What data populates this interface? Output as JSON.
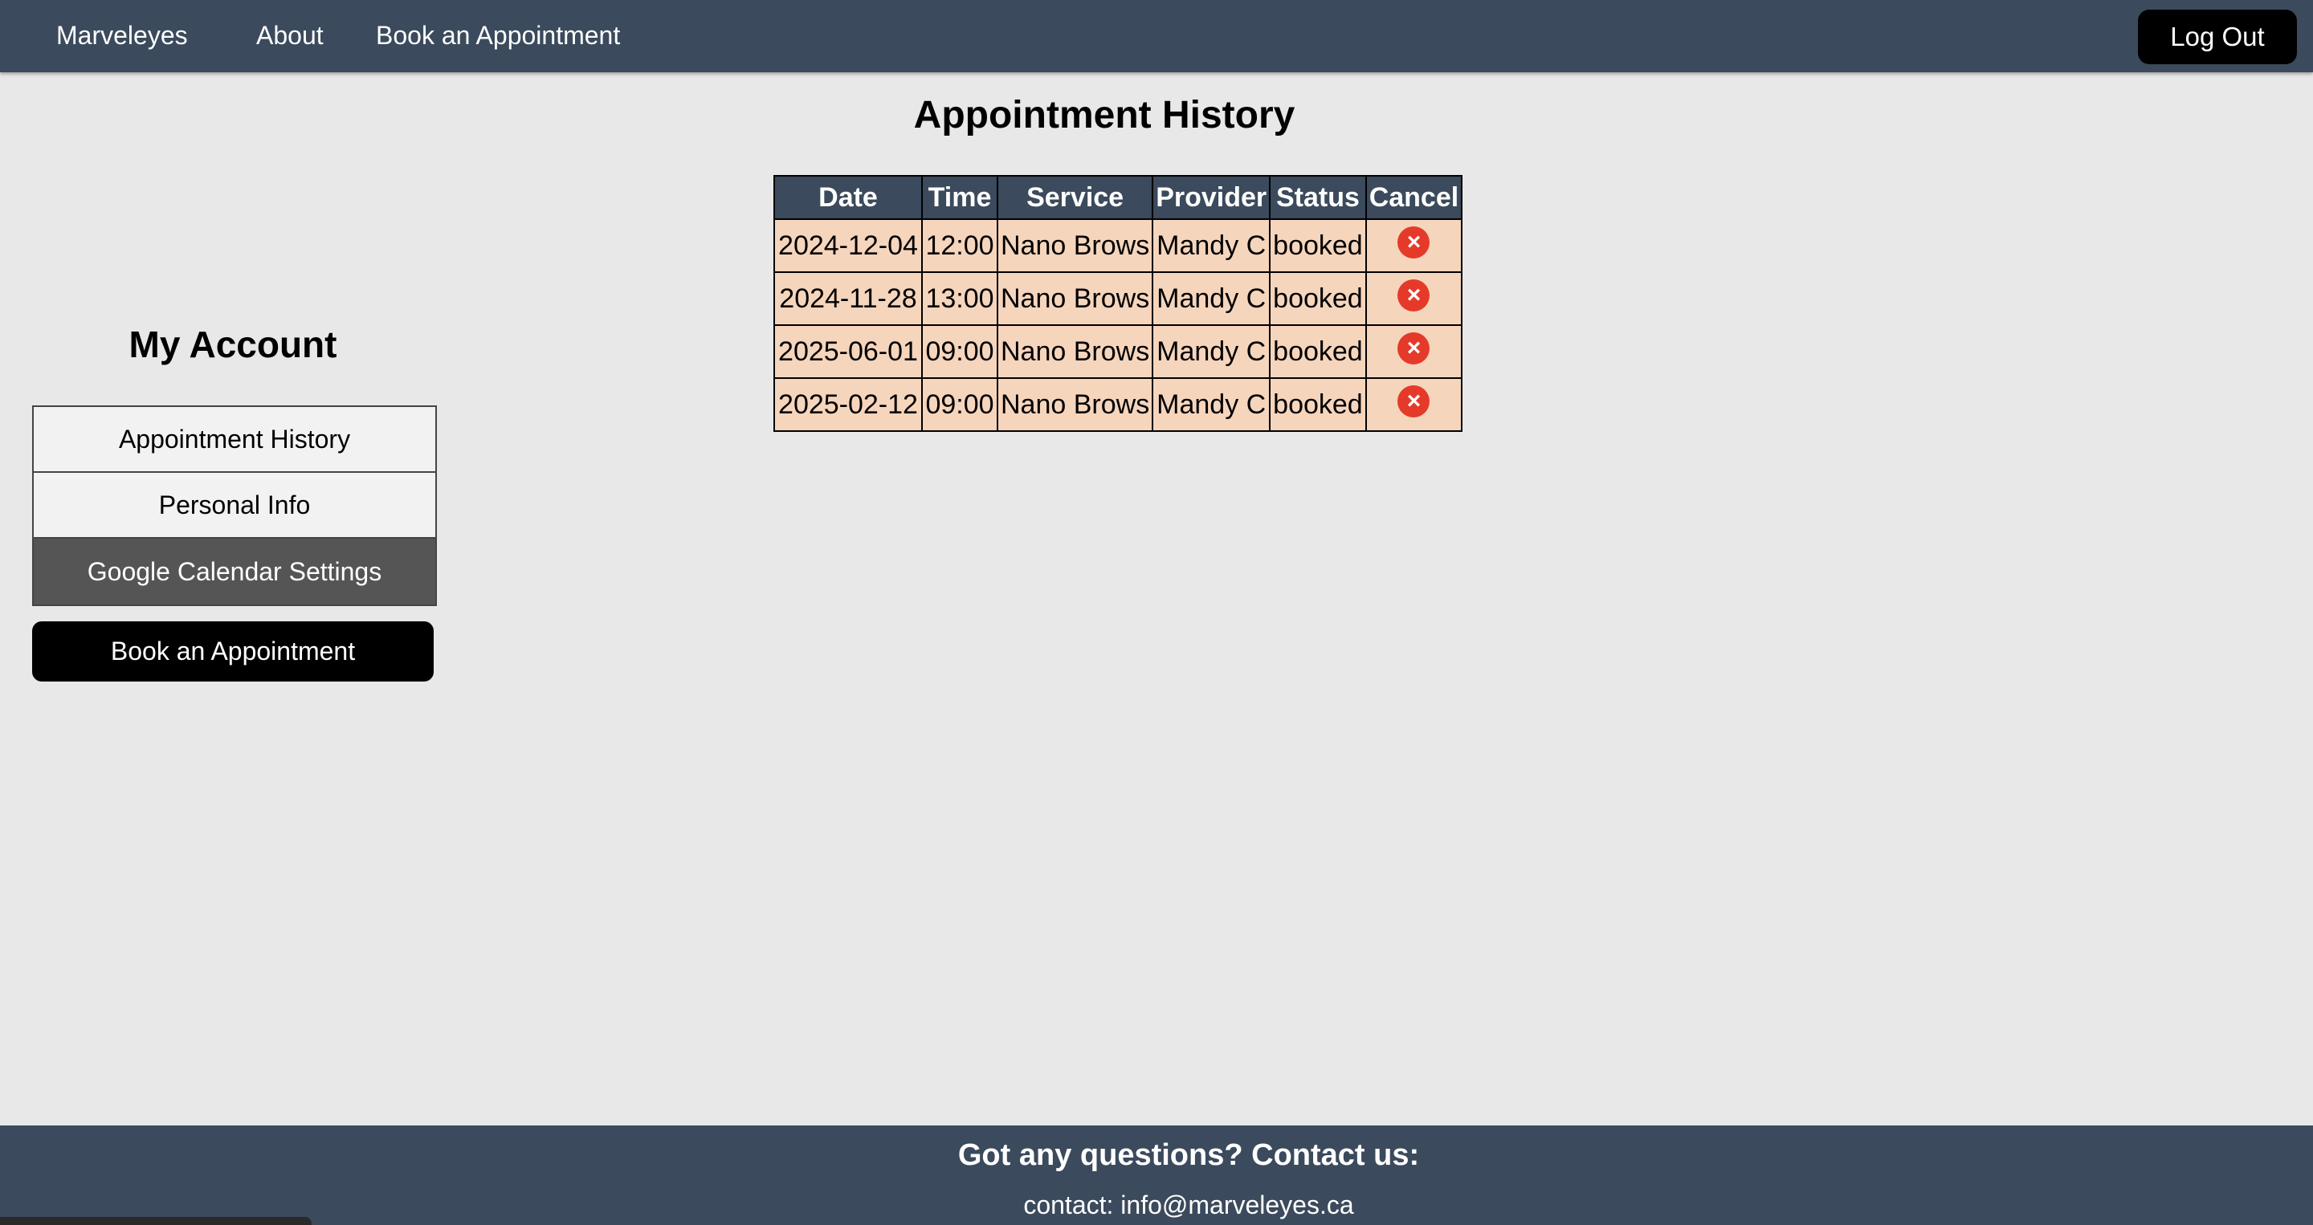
{
  "nav": {
    "brand": "Marveleyes",
    "about": "About",
    "book": "Book an Appointment",
    "logout": "Log Out"
  },
  "main": {
    "title": "Appointment History",
    "table": {
      "headers": [
        "Date",
        "Time",
        "Service",
        "Provider",
        "Status",
        "Cancel"
      ],
      "rows": [
        {
          "date": "2024-12-04",
          "time": "12:00",
          "service": "Nano Brows",
          "provider": "Mandy C",
          "status": "booked"
        },
        {
          "date": "2024-11-28",
          "time": "13:00",
          "service": "Nano Brows",
          "provider": "Mandy C",
          "status": "booked"
        },
        {
          "date": "2025-06-01",
          "time": "09:00",
          "service": "Nano Brows",
          "provider": "Mandy C",
          "status": "booked"
        },
        {
          "date": "2025-02-12",
          "time": "09:00",
          "service": "Nano Brows",
          "provider": "Mandy C",
          "status": "booked"
        }
      ],
      "cancel_icon": "close-circle-icon"
    }
  },
  "sidebar": {
    "title": "My Account",
    "items": [
      {
        "label": "Appointment History",
        "active": false
      },
      {
        "label": "Personal Info",
        "active": false
      },
      {
        "label": "Google Calendar Settings",
        "active": true
      }
    ],
    "book_button": "Book an Appointment"
  },
  "footer": {
    "heading": "Got any questions? Contact us:",
    "contact": "contact: info@marveleyes.ca"
  },
  "colors": {
    "nav_bg": "#3b4a5c",
    "row_bg": "#f6d5bd",
    "cancel_red": "#e53a2a",
    "active_menu": "#555555"
  }
}
